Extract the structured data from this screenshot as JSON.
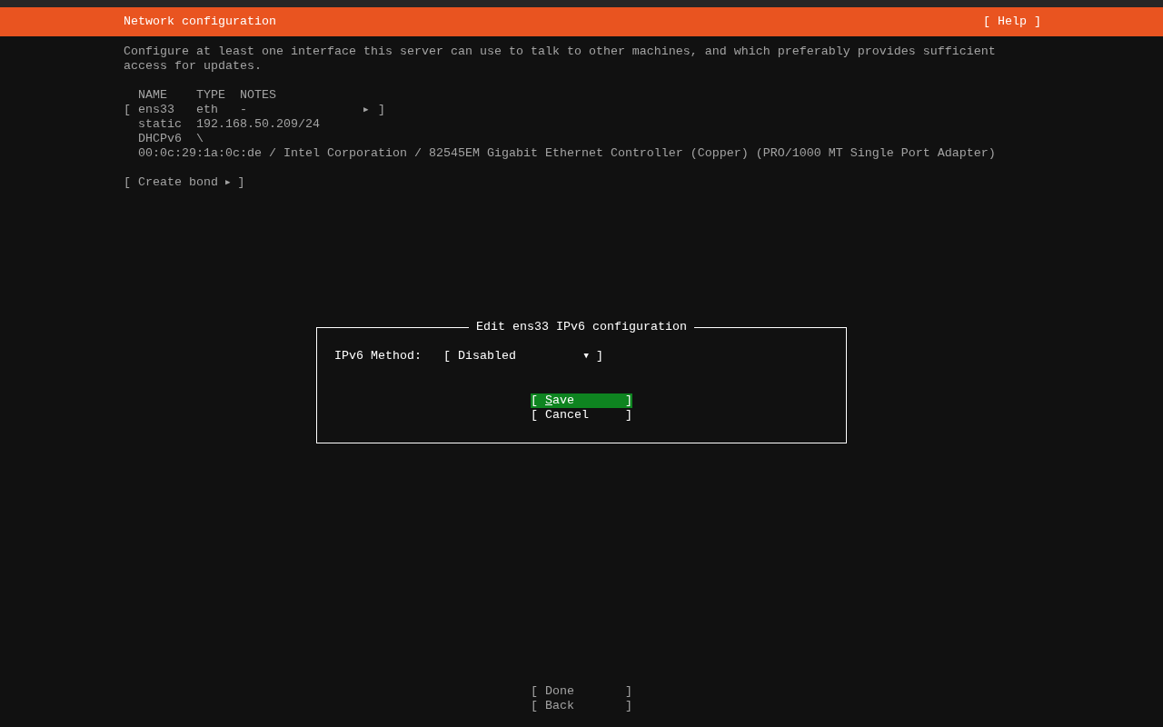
{
  "header": {
    "title": "Network configuration",
    "help": "[ Help ]"
  },
  "description": "Configure at least one interface this server can use to talk to other machines, and which preferably provides sufficient access for updates.",
  "interfaces": {
    "columns": [
      "NAME",
      "TYPE",
      "NOTES"
    ],
    "rows": [
      {
        "open": "[",
        "name": "ens33",
        "type": "eth",
        "notes": "-",
        "arrow": "▶",
        "close": "]",
        "addresses": [
          {
            "method": "static",
            "value": "192.168.50.209/24"
          },
          {
            "method": "DHCPv6",
            "value": "\\"
          }
        ],
        "details": "00:0c:29:1a:0c:de / Intel Corporation / 82545EM Gigabit Ethernet Controller (Copper) (PRO/1000 MT Single Port Adapter)"
      }
    ]
  },
  "create_bond": {
    "open": "[",
    "label": "Create bond",
    "arrow": "▶",
    "close": "]"
  },
  "dialog": {
    "title": "Edit ens33 IPv6 configuration",
    "fields": [
      {
        "label": "IPv6 Method:",
        "open": "[",
        "value": "Disabled",
        "arrow": "▼",
        "close": "]"
      }
    ],
    "buttons": [
      {
        "open": "[",
        "label": "Save",
        "close": "]",
        "focused": true
      },
      {
        "open": "[",
        "label": "Cancel",
        "close": "]",
        "focused": false
      }
    ]
  },
  "footer_buttons": [
    {
      "open": "[",
      "label": "Done",
      "close": "]",
      "focused": false
    },
    {
      "open": "[",
      "label": "Back",
      "close": "]",
      "focused": false
    }
  ]
}
